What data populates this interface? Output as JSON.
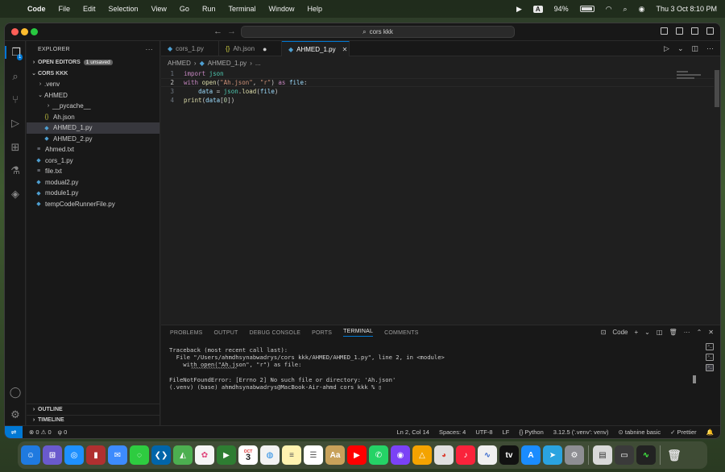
{
  "menubar": {
    "apple_icon": "apple-logo-icon",
    "app_name": "Code",
    "items": [
      "File",
      "Edit",
      "Selection",
      "View",
      "Go",
      "Run",
      "Terminal",
      "Window",
      "Help"
    ],
    "input_badge": "A",
    "battery": "94%",
    "datetime": "Thu 3 Oct  8:10 PM"
  },
  "titlebar": {
    "search": "cors kkk"
  },
  "activitybar": {
    "explorer_badge": "1"
  },
  "sidebar": {
    "title": "EXPLORER",
    "open_editors": "OPEN EDITORS",
    "unsaved_badge": "1 unsaved",
    "folder": "CORS KKK",
    "tree": [
      {
        "label": ".venv",
        "kind": "folder-collapsed",
        "depth": 1
      },
      {
        "label": "AHMED",
        "kind": "folder-open",
        "depth": 1
      },
      {
        "label": "__pycache__",
        "kind": "folder-collapsed",
        "depth": 2
      },
      {
        "label": "Ah.json",
        "kind": "json",
        "depth": 2
      },
      {
        "label": "AHMED_1.py",
        "kind": "py",
        "depth": 2,
        "selected": true
      },
      {
        "label": "AHMED_2.py",
        "kind": "py",
        "depth": 2
      },
      {
        "label": "Ahmed.txt",
        "kind": "txt",
        "depth": 1
      },
      {
        "label": "cors_1.py",
        "kind": "py",
        "depth": 1
      },
      {
        "label": "file.txt",
        "kind": "txt",
        "depth": 1
      },
      {
        "label": "modual2.py",
        "kind": "py",
        "depth": 1
      },
      {
        "label": "module1.py",
        "kind": "py",
        "depth": 1
      },
      {
        "label": "tempCodeRunnerFile.py",
        "kind": "py",
        "depth": 1
      }
    ],
    "outline": "OUTLINE",
    "timeline": "TIMELINE"
  },
  "tabs": [
    {
      "label": "cors_1.py",
      "icon": "python-file-icon",
      "active": false
    },
    {
      "label": "Ah.json",
      "icon": "json-file-icon",
      "active": false
    },
    {
      "label": "AHMED_1.py",
      "icon": "python-file-icon",
      "active": true
    }
  ],
  "breadcrumbs": [
    "AHMED",
    "AHMED_1.py",
    "..."
  ],
  "code": {
    "line_numbers": [
      "1",
      "2",
      "3",
      "4"
    ]
  },
  "panel": {
    "tabs": [
      "PROBLEMS",
      "OUTPUT",
      "DEBUG CONSOLE",
      "PORTS",
      "TERMINAL",
      "COMMENTS"
    ],
    "active_tab": "TERMINAL",
    "shell_label": "Code",
    "terminal_lines": [
      "Traceback (most recent call last):",
      "  File \"/Users/ahmdhsynabwadrys/cors kkk/AHMED/AHMED_1.py\", line 2, in <module>",
      "    with open(\"Ah.json\", \"r\") as file:",
      "         ^^^^^^^^^^^^^^^^^^^",
      "FileNotFoundError: [Errno 2] No such file or directory: 'Ah.json'",
      "(.venv) (base) ahmdhsynabwadrys@MacBook-Air-ahmd cors kkk % "
    ]
  },
  "statusbar": {
    "errors": "0",
    "warnings": "0",
    "ports": "0",
    "position": "Ln 2, Col 14",
    "spaces": "Spaces: 4",
    "encoding": "UTF-8",
    "eol": "LF",
    "language": "Python",
    "interpreter": "3.12.5 ('.venv': venv)",
    "tabnine": "tabnine basic",
    "prettier": "Prettier"
  },
  "dock": {
    "calendar_month": "OCT",
    "calendar_day": "3"
  }
}
